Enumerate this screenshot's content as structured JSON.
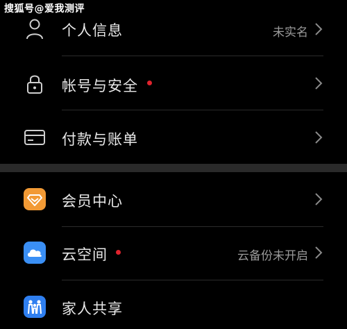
{
  "watermark": "搜狐号@爱我测评",
  "colors": {
    "background": "#000000",
    "section_gap": "#2a2a2a",
    "badge_red": "#e0232d",
    "member_orange": "#f29a35",
    "cloud_blue": "#3a8ff5",
    "family_blue": "#2f7ff0"
  },
  "section1": {
    "items": [
      {
        "label": "个人信息",
        "value": "未实名",
        "icon": "person-icon"
      },
      {
        "label": "帐号与安全",
        "value": "",
        "icon": "lock-icon",
        "badge": true
      },
      {
        "label": "付款与账单",
        "value": "",
        "icon": "card-icon"
      }
    ]
  },
  "section2": {
    "items": [
      {
        "label": "会员中心",
        "value": "",
        "icon": "diamond-icon"
      },
      {
        "label": "云空间",
        "value": "云备份未开启",
        "icon": "cloud-icon",
        "badge": true
      },
      {
        "label": "家人共享",
        "value": "",
        "icon": "family-icon"
      }
    ]
  }
}
